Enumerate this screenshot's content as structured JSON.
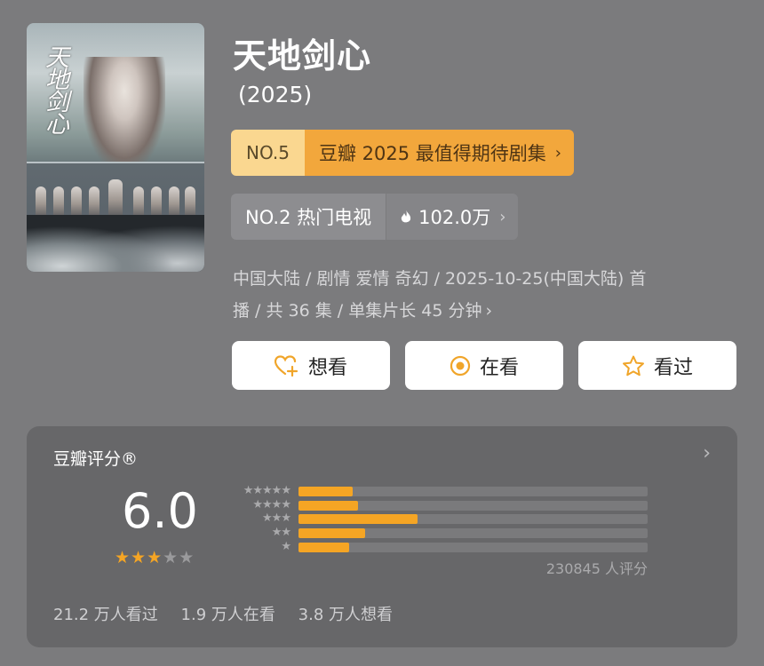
{
  "poster": {
    "calligraphy": "天地剑心"
  },
  "title": "天地剑心",
  "year": "(2025)",
  "rank1": {
    "no": "NO.5",
    "label": "豆瓣 2025 最值得期待剧集",
    "chev": "›"
  },
  "rank2": {
    "no_label": "NO.2 热门电视",
    "heat": "102.0万",
    "chev": "›"
  },
  "meta": {
    "line1": "中国大陆 / 剧情 爱情 奇幻 / 2025-10-25(中国大陆) 首",
    "line2": "播 / 共 36 集 / 单集片长 45 分钟",
    "chev": "›"
  },
  "buttons": {
    "want": "想看",
    "watching": "在看",
    "watched": "看过"
  },
  "rating": {
    "title": "豆瓣评分®",
    "arrow": "›",
    "score": "6.0",
    "stars_full": 3,
    "star_glyph": "★",
    "row_labels": [
      "★★★★★",
      "★★★★",
      "★★★",
      "★★",
      "★"
    ],
    "distribution": [
      {
        "stars": 5,
        "fraction": 0.155
      },
      {
        "stars": 4,
        "fraction": 0.17
      },
      {
        "stars": 3,
        "fraction": 0.34
      },
      {
        "stars": 2,
        "fraction": 0.19
      },
      {
        "stars": 1,
        "fraction": 0.145
      }
    ],
    "count": "230845 人评分",
    "watched": "21.2 万人看过",
    "watching": "1.9 万人在看",
    "want": "3.8 万人想看"
  },
  "colors": {
    "accent": "#f5a524",
    "rank_bg": "#f2a73c",
    "rank_no_bg": "#fad790"
  }
}
